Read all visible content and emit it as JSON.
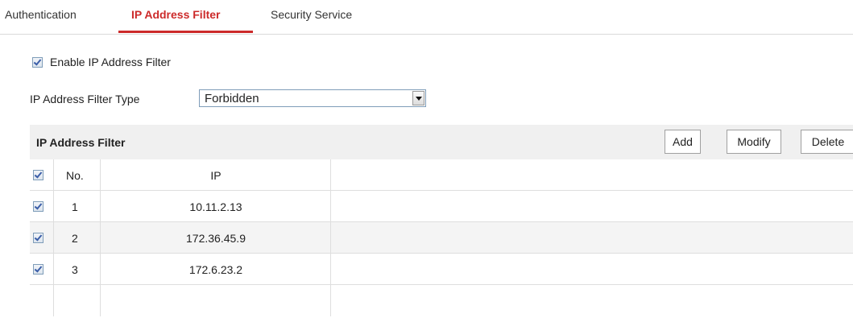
{
  "tabs": [
    {
      "label": "Authentication",
      "active": false
    },
    {
      "label": "IP Address Filter",
      "active": true
    },
    {
      "label": "Security Service",
      "active": false
    }
  ],
  "accent_color": "#cc2a2a",
  "enable": {
    "label": "Enable IP Address Filter",
    "checked": true
  },
  "filter_type": {
    "label": "IP Address Filter Type",
    "selected": "Forbidden"
  },
  "panel": {
    "title": "IP Address Filter",
    "buttons": {
      "add": "Add",
      "modify": "Modify",
      "delete": "Delete"
    }
  },
  "table": {
    "columns": {
      "no": "No.",
      "ip": "IP"
    },
    "rows": [
      {
        "no": "1",
        "ip": "10.11.2.13",
        "checked": true
      },
      {
        "no": "2",
        "ip": "172.36.45.9",
        "checked": true
      },
      {
        "no": "3",
        "ip": "172.6.23.2",
        "checked": true
      }
    ]
  }
}
